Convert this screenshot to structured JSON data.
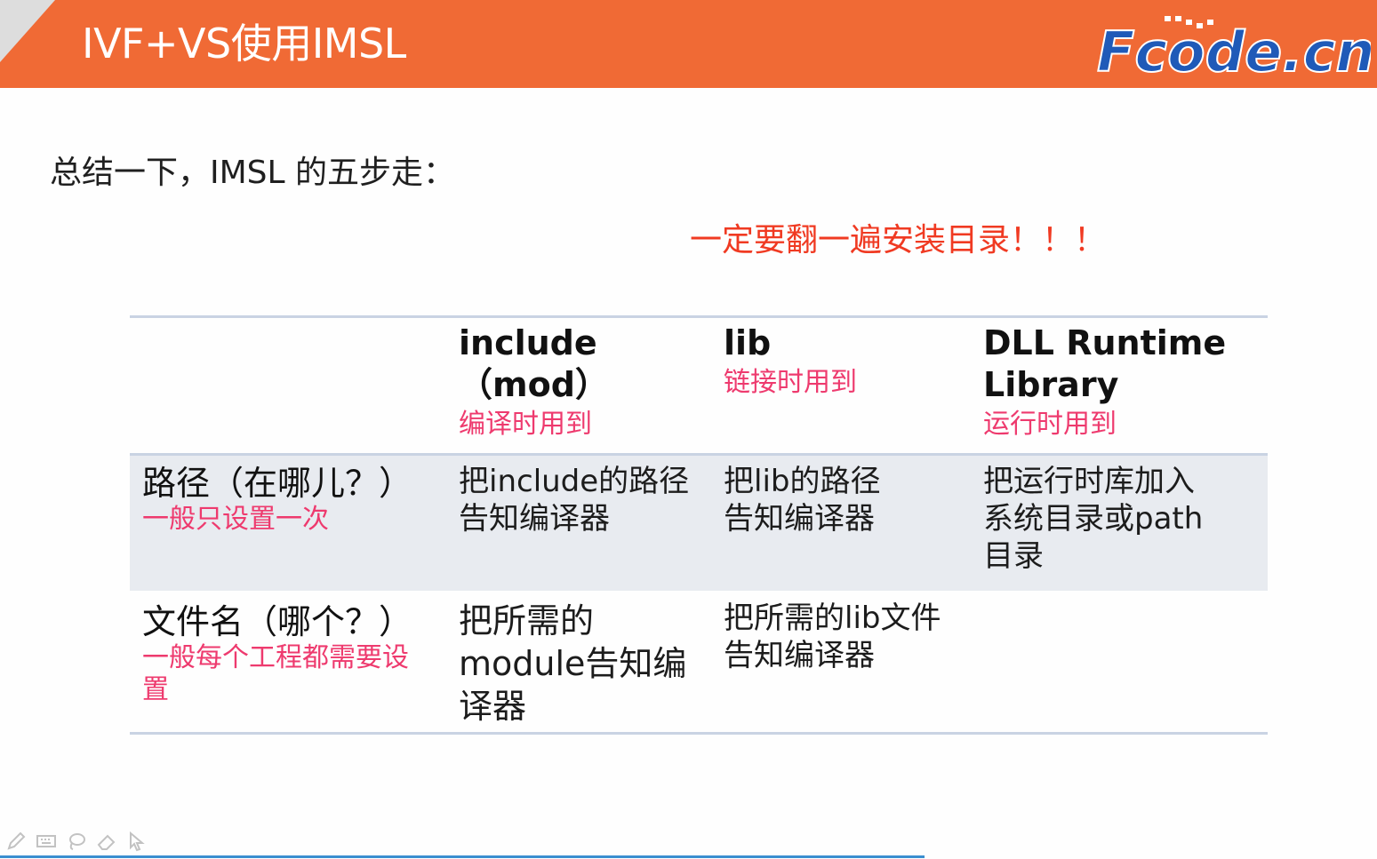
{
  "header": {
    "title": "IVF+VS使用IMSL",
    "logo_text": "Fcode.cn",
    "background_color": "#f06a35"
  },
  "summary": "总结一下，IMSL 的五步走：",
  "warning": "一定要翻一遍安装目录！！！",
  "table": {
    "columns": [
      {
        "title_lines": [
          "include",
          "（mod）"
        ],
        "subtitle": "编译时用到"
      },
      {
        "title_lines": [
          "lib"
        ],
        "subtitle": "链接时用到"
      },
      {
        "title_lines": [
          "DLL Runtime",
          "Library"
        ],
        "subtitle": "运行时用到"
      }
    ],
    "rows": [
      {
        "label": "路径（在哪儿？）",
        "note": "一般只设置一次",
        "cells": [
          "把include的路径告知编译器",
          "把lib的路径告知编译器",
          "把运行时库加入系统目录或path目录"
        ]
      },
      {
        "label": "文件名（哪个？）",
        "note": "一般每个工程都需要设置",
        "cells": [
          "把所需的module告知编译器",
          "把所需的lib文件告知编译器",
          ""
        ]
      }
    ]
  },
  "toolbar": {
    "icons": [
      "pen-icon",
      "keyboard-icon",
      "lasso-icon",
      "eraser-icon",
      "pointer-icon"
    ]
  },
  "colors": {
    "accent": "#f06a35",
    "warning": "#f03a22",
    "note": "#ee3a6e",
    "row_shade": "#e8ebf0",
    "logo_blue": "#1f5ab8"
  }
}
